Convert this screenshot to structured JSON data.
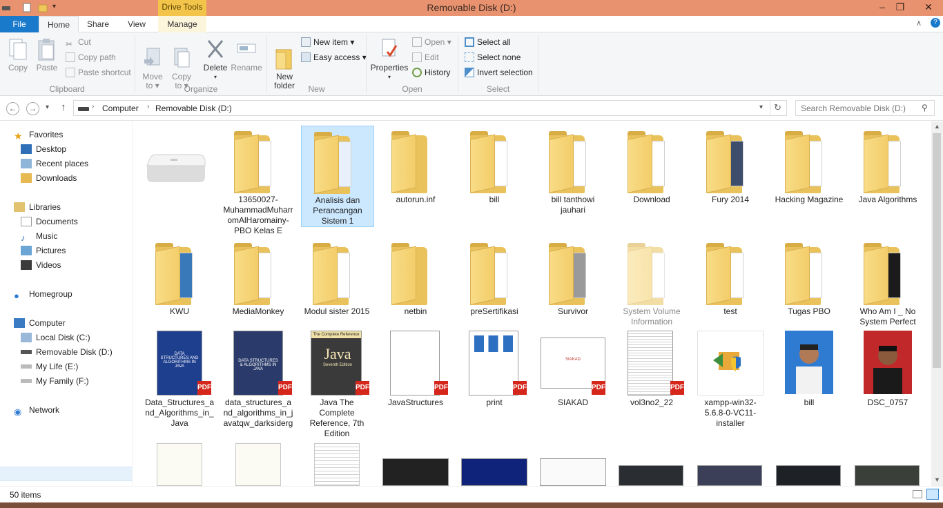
{
  "window": {
    "title": "Removable Disk (D:)",
    "context_tab": "Drive Tools",
    "min": "–",
    "max": "❐",
    "close": "✕"
  },
  "ribbon_tabs": [
    "File",
    "Home",
    "Share",
    "View",
    "Manage"
  ],
  "ribbon": {
    "clipboard": {
      "label": "Clipboard",
      "copy": "Copy",
      "paste": "Paste",
      "cut": "Cut",
      "copy_path": "Copy path",
      "paste_shortcut": "Paste shortcut"
    },
    "organize": {
      "label": "Organize",
      "move_to": "Move\nto ▾",
      "copy_to": "Copy\nto ▾",
      "delete": "Delete",
      "rename": "Rename"
    },
    "new": {
      "label": "New",
      "new_folder": "New\nfolder",
      "new_item": "New item ▾",
      "easy_access": "Easy access ▾"
    },
    "open": {
      "label": "Open",
      "properties": "Properties",
      "open": "Open ▾",
      "edit": "Edit",
      "history": "History"
    },
    "select": {
      "label": "Select",
      "select_all": "Select all",
      "select_none": "Select none",
      "invert": "Invert selection"
    }
  },
  "address": {
    "crumbs": [
      "Computer",
      "Removable Disk (D:)"
    ],
    "search_placeholder": "Search Removable Disk (D:)"
  },
  "nav": {
    "favorites": "Favorites",
    "desktop": "Desktop",
    "recent": "Recent places",
    "downloads": "Downloads",
    "libraries": "Libraries",
    "documents": "Documents",
    "music": "Music",
    "pictures": "Pictures",
    "videos": "Videos",
    "homegroup": "Homegroup",
    "computer": "Computer",
    "local_c": "Local Disk (C:)",
    "removable_d": "Removable Disk (D:)",
    "mylife_e": "My Life (E:)",
    "myfamily_f": "My Family (F:)",
    "network": "Network"
  },
  "items": {
    "r1": [
      "",
      "13650027-MuhammadMuharromAlHaromainy-PBO Kelas E",
      "Analisis dan Perancangan Sistem 1",
      "autorun.inf",
      "bill",
      "bill tanthowi jauhari",
      "Download",
      "Fury 2014",
      "Hacking Magazine",
      "Java Algorithms"
    ],
    "r2": [
      "KWU",
      "MediaMonkey",
      "Modul sister 2015",
      "netbin",
      "preSertifikasi",
      "Survivor",
      "System Volume Information",
      "test",
      "Tugas PBO",
      "Who Am I _ No System Perfect"
    ],
    "r3": [
      "Data_Structures_and_Algorithms_in_Java",
      "data_structures_and_algorithms_in_javatqw_darksiderg",
      "Java The Complete Reference, 7th Edition",
      "JavaStructures",
      "print",
      "SIAKAD",
      "vol3no2_22",
      "xampp-win32-5.6.8-0-VC11-installer",
      "bill",
      "DSC_0757"
    ]
  },
  "thumbs": {
    "ds_title": "DATA STRUCTURES AND ALGORITHMS IN JAVA",
    "ds2_title": "DATA STRUCTURES & ALGORITHMS IN JAVA",
    "java_title": "Java",
    "java_top": "The Complete Reference",
    "java_ed": "Seventh Edition",
    "siakad": "SIAKAD",
    "pdf": "PDF"
  },
  "status": {
    "count": "50 items"
  },
  "colors": {
    "accent": "#1979ca",
    "title_bar": "#e8926f",
    "drive_tools": "#f2c44a",
    "selection": "#cce8ff"
  }
}
